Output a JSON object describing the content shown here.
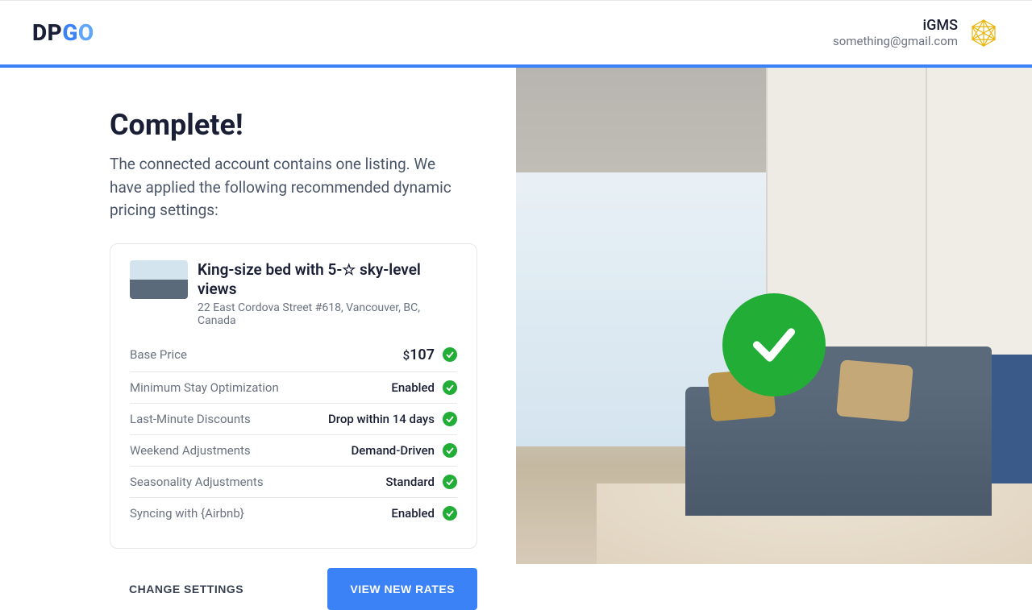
{
  "header": {
    "logo_dp": "DP",
    "logo_g": "G",
    "logo_o": "O",
    "account_name": "iGMS",
    "account_email": "something@gmail.com"
  },
  "panel": {
    "title": "Complete!",
    "description": "The connected account contains one listing. We have applied the following recommended dynamic pricing settings:"
  },
  "listing": {
    "title": "King-size bed with 5-☆ sky-level views",
    "address": "22 East Cordova Street #618, Vancouver, BC, Canada",
    "currency": "$",
    "price": "107"
  },
  "settings": [
    {
      "label": "Base Price",
      "value_type": "price"
    },
    {
      "label": "Minimum Stay Optimization",
      "value": "Enabled"
    },
    {
      "label": "Last-Minute Discounts",
      "value": "Drop within 14 days"
    },
    {
      "label": "Weekend Adjustments",
      "value": "Demand-Driven"
    },
    {
      "label": "Seasonality Adjustments",
      "value": "Standard"
    },
    {
      "label": "Syncing with {Airbnb}",
      "value": "Enabled"
    }
  ],
  "buttons": {
    "change": "CHANGE SETTINGS",
    "view": "VIEW NEW RATES"
  }
}
